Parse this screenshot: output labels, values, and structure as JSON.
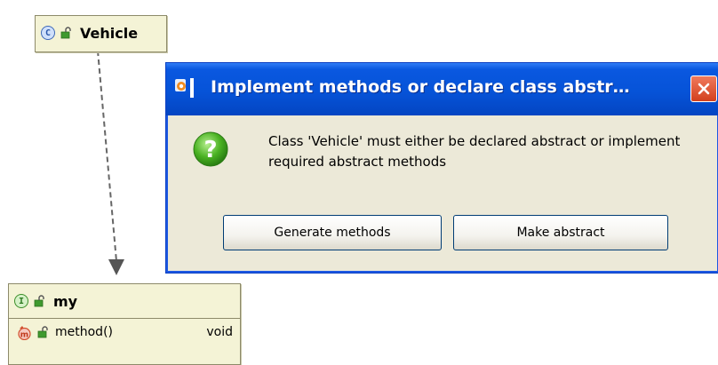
{
  "diagram": {
    "vehicle": {
      "badge": "C",
      "name": "Vehicle"
    },
    "my": {
      "badge": "I",
      "name": "my",
      "methods": [
        {
          "name": "method()",
          "type": "void"
        }
      ]
    }
  },
  "dialog": {
    "title": "Implement methods or declare class abstr…",
    "message": "Class 'Vehicle' must either be declared abstract or implement required abstract methods",
    "buttons": {
      "generate": "Generate methods",
      "make_abstract": "Make abstract"
    },
    "icons": {
      "app": "intellij-app-icon",
      "question": "question-icon",
      "close": "close-icon"
    }
  },
  "colors": {
    "node_fill": "#f4f3d6",
    "title_bar": "#0653d8",
    "dialog_body": "#ece9d8",
    "close_button": "#d2401d"
  }
}
